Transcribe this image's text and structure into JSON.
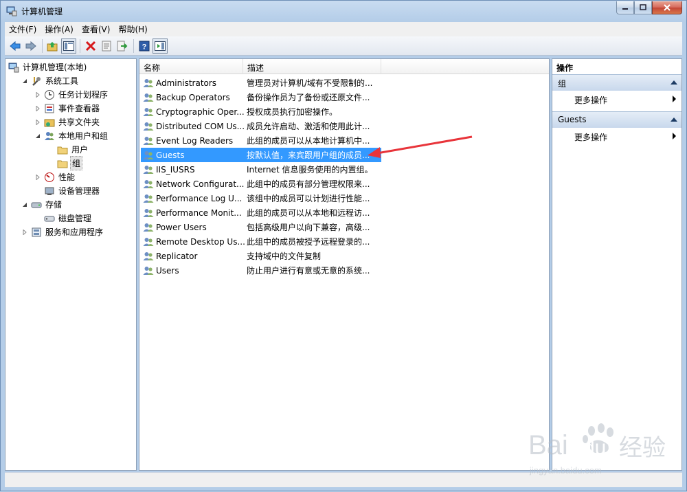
{
  "window": {
    "title": "计算机管理"
  },
  "menu": [
    "文件(F)",
    "操作(A)",
    "查看(V)",
    "帮助(H)"
  ],
  "toolbar": {
    "buttons": [
      "back-icon",
      "forward-icon",
      "up-folder-icon",
      "show-hide-tree-icon",
      "delete-icon",
      "properties-icon",
      "export-list-icon",
      "help-icon",
      "show-action-pane-icon"
    ]
  },
  "tree": [
    {
      "label": "计算机管理(本地)",
      "level": 0,
      "toggle": "none",
      "icon": "computer-icon"
    },
    {
      "label": "系统工具",
      "level": 1,
      "toggle": "expanded",
      "icon": "tools-icon"
    },
    {
      "label": "任务计划程序",
      "level": 2,
      "toggle": "collapsed",
      "icon": "clock-icon"
    },
    {
      "label": "事件查看器",
      "level": 2,
      "toggle": "collapsed",
      "icon": "event-viewer-icon"
    },
    {
      "label": "共享文件夹",
      "level": 2,
      "toggle": "collapsed",
      "icon": "shared-folder-icon"
    },
    {
      "label": "本地用户和组",
      "level": 2,
      "toggle": "expanded",
      "icon": "users-icon"
    },
    {
      "label": "用户",
      "level": 3,
      "toggle": "none",
      "icon": "folder-icon"
    },
    {
      "label": "组",
      "level": 3,
      "toggle": "none",
      "icon": "folder-icon",
      "selected": true
    },
    {
      "label": "性能",
      "level": 2,
      "toggle": "collapsed",
      "icon": "performance-icon"
    },
    {
      "label": "设备管理器",
      "level": 2,
      "toggle": "none",
      "icon": "device-manager-icon"
    },
    {
      "label": "存储",
      "level": 1,
      "toggle": "expanded",
      "icon": "storage-icon"
    },
    {
      "label": "磁盘管理",
      "level": 2,
      "toggle": "none",
      "icon": "disk-icon"
    },
    {
      "label": "服务和应用程序",
      "level": 1,
      "toggle": "collapsed",
      "icon": "services-icon"
    }
  ],
  "list": {
    "columns": [
      "名称",
      "描述"
    ],
    "rows": [
      {
        "name": "Administrators",
        "desc": "管理员对计算机/域有不受限制的..."
      },
      {
        "name": "Backup Operators",
        "desc": "备份操作员为了备份或还原文件..."
      },
      {
        "name": "Cryptographic Oper...",
        "desc": "授权成员执行加密操作。"
      },
      {
        "name": "Distributed COM Us...",
        "desc": "成员允许启动、激活和使用此计..."
      },
      {
        "name": "Event Log Readers",
        "desc": "此组的成员可以从本地计算机中..."
      },
      {
        "name": "Guests",
        "desc": "按默认值，来宾跟用户组的成员...",
        "selected": true
      },
      {
        "name": "IIS_IUSRS",
        "desc": "Internet 信息服务使用的内置组。"
      },
      {
        "name": "Network Configurat...",
        "desc": "此组中的成员有部分管理权限来..."
      },
      {
        "name": "Performance Log U...",
        "desc": "该组中的成员可以计划进行性能..."
      },
      {
        "name": "Performance Monit...",
        "desc": "此组的成员可以从本地和远程访..."
      },
      {
        "name": "Power Users",
        "desc": "包括高级用户以向下兼容，高级..."
      },
      {
        "name": "Remote Desktop Us...",
        "desc": "此组中的成员被授予远程登录的..."
      },
      {
        "name": "Replicator",
        "desc": "支持域中的文件复制"
      },
      {
        "name": "Users",
        "desc": "防止用户进行有意或无意的系统..."
      }
    ]
  },
  "actions": {
    "header": "操作",
    "groups": [
      {
        "title": "组",
        "items": [
          "更多操作"
        ]
      },
      {
        "title": "Guests",
        "items": [
          "更多操作"
        ]
      }
    ]
  },
  "watermark": {
    "brand": "Bai",
    "brand2": "du",
    "brand3": "经验",
    "url": "jingyan.baidu.com"
  },
  "colors": {
    "selection": "#3399ff",
    "annotation_arrow": "#e8343a"
  }
}
